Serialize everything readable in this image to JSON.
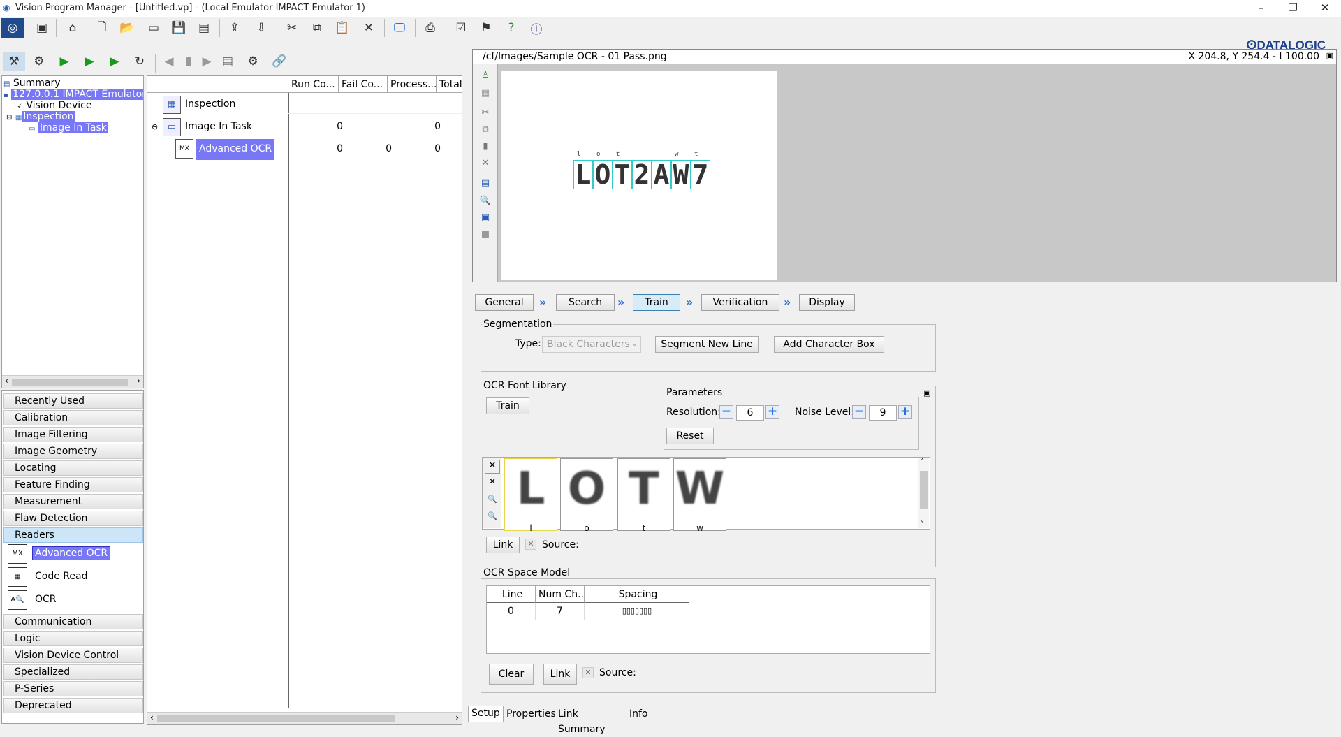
{
  "window": {
    "title": "Vision Program Manager - [Untitled.vp] - (Local Emulator IMPACT Emulator 1)",
    "controls": [
      "–",
      "❐",
      "✕"
    ]
  },
  "brand": "ⵙDATALOGIC",
  "tree": {
    "summary": "Summary",
    "emulator": "127.0.0.1 IMPACT Emulator 1",
    "vision_device": "Vision Device",
    "inspection": "Inspection",
    "image_in_task": "Image In Task"
  },
  "categories": [
    "Recently Used",
    "Calibration",
    "Image Filtering",
    "Image Geometry",
    "Locating",
    "Feature Finding",
    "Measurement",
    "Flaw Detection",
    "Readers"
  ],
  "reader_tools": [
    "Advanced OCR",
    "Code Read",
    "OCR"
  ],
  "categories_after": [
    "Communication",
    "Logic",
    "Vision Device Control",
    "Specialized",
    "P-Series",
    "Deprecated"
  ],
  "table": {
    "columns": [
      "Run Co...",
      "Fail Co...",
      "Process...",
      "Total"
    ],
    "rows": [
      {
        "name": "Inspection",
        "run": "",
        "fail": "",
        "process": ""
      },
      {
        "name": "Image In Task",
        "run": "0",
        "fail": "",
        "process": "0"
      },
      {
        "name": "Advanced OCR",
        "run": "0",
        "fail": "0",
        "process": "0"
      }
    ]
  },
  "image": {
    "path": "/cf/Images/Sample OCR - 01 Pass.png",
    "coords": "X 204.8,  Y 254.4  -  I 100.00",
    "ocr_text": "LOT2AW7",
    "char_labels": [
      "l",
      "o",
      "t",
      "",
      "",
      "w",
      "t"
    ]
  },
  "wizard": {
    "tabs": [
      "General",
      "Search",
      "Train",
      "Verification",
      "Display"
    ],
    "selected": "Train"
  },
  "segmentation": {
    "label": "Segmentation",
    "type_label": "Type:",
    "type_value": "Black Characters",
    "segment_btn": "Segment New Line",
    "add_box_btn": "Add Character Box"
  },
  "font_library": {
    "label": "OCR Font Library",
    "train_btn": "Train",
    "params_label": "Parameters",
    "resolution_label": "Resolution:",
    "resolution": "6",
    "noise_label": "Noise Level:",
    "noise": "9",
    "reset_btn": "Reset",
    "chars": [
      {
        "glyph": "L",
        "label": "l"
      },
      {
        "glyph": "O",
        "label": "o"
      },
      {
        "glyph": "T",
        "label": "t"
      },
      {
        "glyph": "W",
        "label": "w"
      }
    ],
    "link_btn": "Link",
    "source_label": "Source:"
  },
  "space_model": {
    "label": "OCR Space Model",
    "columns": [
      "Line",
      "Num Ch...",
      "Spacing"
    ],
    "rows": [
      {
        "line": "0",
        "num": "7",
        "spacing": "▯▯▯▯▯▯▯"
      }
    ],
    "clear_btn": "Clear",
    "link_btn": "Link",
    "source_label": "Source:"
  },
  "bottom_tabs": [
    "Setup",
    "Properties",
    "Link Summary",
    "Info"
  ]
}
